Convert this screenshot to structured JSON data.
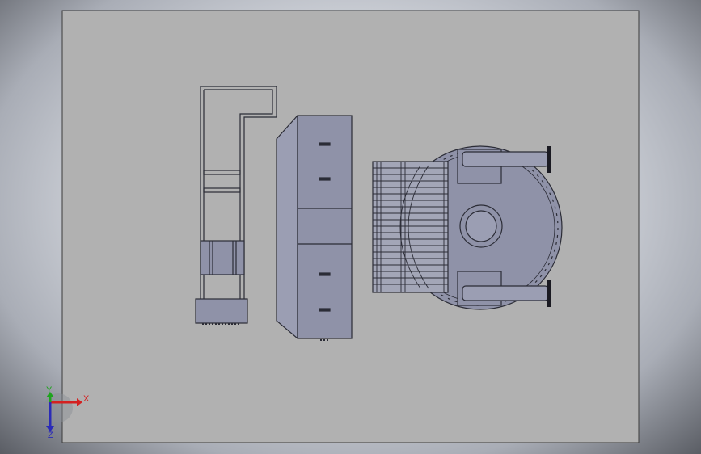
{
  "viewport": {
    "sheet_color": "#b1b1b1",
    "part_fill": "#8f92a8",
    "part_fill_light": "#9b9eb3",
    "edge_color": "#2b2c36"
  },
  "triad": {
    "x_label": "X",
    "y_label": "Y",
    "z_label": "Z",
    "x_color": "#d42020",
    "y_color": "#1ea31e",
    "z_color": "#2a2ab8"
  }
}
